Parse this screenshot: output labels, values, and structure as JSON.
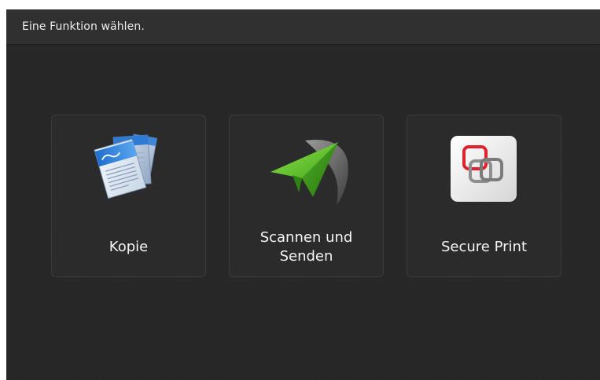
{
  "header": {
    "prompt": "Eine Funktion wählen."
  },
  "functions": [
    {
      "label": "Kopie",
      "icon": "copy-documents-icon"
    },
    {
      "label": "Scannen und Senden",
      "icon": "paper-plane-send-icon"
    },
    {
      "label": "Secure Print",
      "icon": "secure-print-icon"
    }
  ],
  "colors": {
    "background": "#262626",
    "header": "#303030",
    "tile": "#2b2b2b",
    "plane_green": "#5ec227",
    "secure_red": "#e0212c"
  }
}
